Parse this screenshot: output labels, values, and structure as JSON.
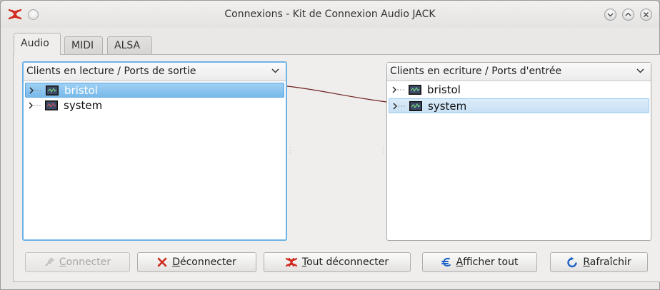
{
  "window": {
    "title": "Connexions - Kit de Connexion Audio JACK",
    "app_icon": "jack-logo-icon",
    "accent_color": "#6db2e6"
  },
  "tabs": [
    {
      "label": "Audio",
      "active": true
    },
    {
      "label": "MIDI",
      "active": false
    },
    {
      "label": "ALSA",
      "active": false
    }
  ],
  "left_pane": {
    "header": "Clients en lecture / Ports de sortie",
    "items": [
      {
        "label": "bristol",
        "selected": true
      },
      {
        "label": "system",
        "selected": false
      }
    ]
  },
  "right_pane": {
    "header": "Clients en ecriture / Ports d'entrée",
    "items": [
      {
        "label": "bristol",
        "selected": false
      },
      {
        "label": "system",
        "selected": true
      }
    ]
  },
  "connections": [
    {
      "from": "bristol",
      "to": "system"
    }
  ],
  "buttons": {
    "connect": {
      "mnemonic": "C",
      "rest": "onnecter",
      "enabled": false
    },
    "disconnect": {
      "mnemonic": "D",
      "rest": "éconnecter",
      "enabled": true
    },
    "disconnect_all": {
      "mnemonic": "T",
      "rest": "out déconnecter",
      "enabled": true
    },
    "show_all": {
      "mnemonic": "A",
      "rest": "fficher tout",
      "enabled": true
    },
    "refresh": {
      "mnemonic": "R",
      "rest": "afraîchir",
      "enabled": true
    }
  }
}
